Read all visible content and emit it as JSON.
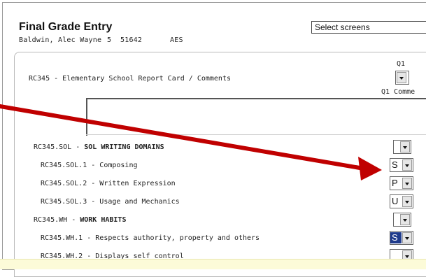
{
  "header": {
    "title": "Final Grade Entry",
    "student_name": "Baldwin, Alec Wayne",
    "grade": "5",
    "student_id": "51642",
    "school": "AES",
    "screens_select": "Select screens"
  },
  "columns": {
    "q1": "Q1",
    "q1_comment": "Q1 Comme"
  },
  "report": {
    "label": "RC345 - Elementary School Report Card / Comments",
    "q1_value": ""
  },
  "rows": [
    {
      "code": "RC345.SOL",
      "desc": "SOL WRITING DOMAINS",
      "heading": true,
      "value": ""
    },
    {
      "code": "RC345.SOL.1",
      "desc": "Composing",
      "heading": false,
      "value": "S"
    },
    {
      "code": "RC345.SOL.2",
      "desc": "Written Expression",
      "heading": false,
      "value": "P"
    },
    {
      "code": "RC345.SOL.3",
      "desc": "Usage and Mechanics",
      "heading": false,
      "value": "U"
    },
    {
      "code": "RC345.WH",
      "desc": "WORK HABITS",
      "heading": true,
      "value": ""
    },
    {
      "code": "RC345.WH.1",
      "desc": "Respects authority, property and others",
      "heading": false,
      "value": "S"
    },
    {
      "code": "RC345.WH.2",
      "desc": "Displays self control",
      "heading": false,
      "value": ""
    }
  ],
  "colors": {
    "arrow": "#c00000",
    "selected_highlight": "#1f3b8c",
    "footer_bar": "#fcfbd8"
  }
}
